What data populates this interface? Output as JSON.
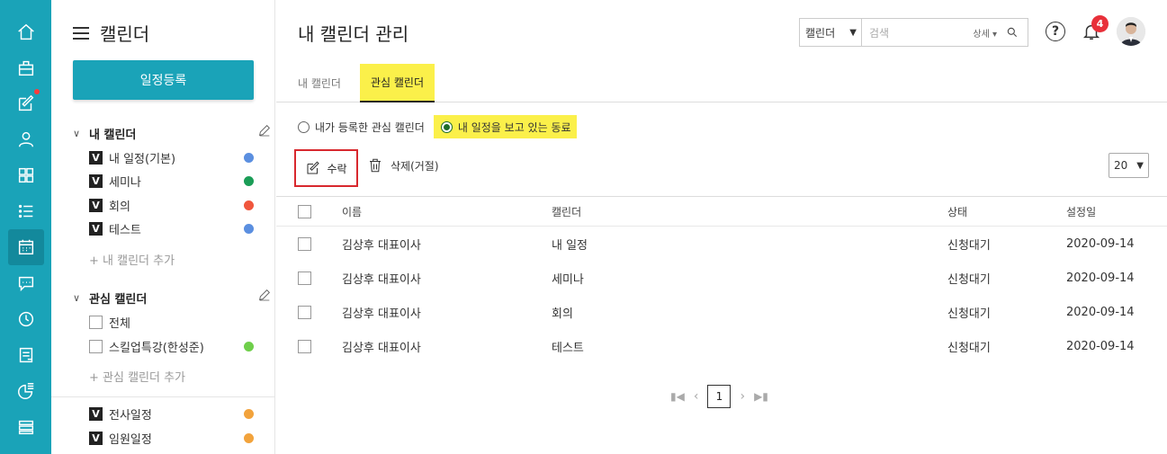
{
  "sidebar": {
    "title": "캘린더",
    "register_label": "일정등록",
    "my_section": {
      "label": "내 캘린더",
      "items": [
        {
          "label": "내 일정(기본)",
          "checked": true,
          "color": "#5b8fe0"
        },
        {
          "label": "세미나",
          "checked": true,
          "color": "#1b9d57"
        },
        {
          "label": "회의",
          "checked": true,
          "color": "#f0563d"
        },
        {
          "label": "테스트",
          "checked": true,
          "color": "#5b8fe0"
        }
      ],
      "add_label": "+ 내 캘린더 추가"
    },
    "interest_section": {
      "label": "관심 캘린더",
      "items": [
        {
          "label": "전체",
          "checked": false,
          "color": ""
        },
        {
          "label": "스킬업특강(한성준)",
          "checked": false,
          "color": "#6fcf4b"
        }
      ],
      "add_label": "+ 관심 캘린더 추가"
    },
    "shared_items": [
      {
        "label": "전사일정",
        "checked": true,
        "color": "#f2a33c"
      },
      {
        "label": "임원일정",
        "checked": true,
        "color": "#f2a33c"
      }
    ]
  },
  "header": {
    "title": "내 캘린더 관리",
    "search_scope": "캘린더",
    "search_placeholder": "검색",
    "search_detail": "상세",
    "notification_count": "4"
  },
  "tabs": [
    {
      "label": "내 캘린더",
      "active": false
    },
    {
      "label": "관심 캘린더",
      "active": true
    }
  ],
  "filters": [
    {
      "label": "내가 등록한 관심 캘린더",
      "selected": false
    },
    {
      "label": "내 일정을 보고 있는 동료",
      "selected": true
    }
  ],
  "actions": {
    "accept_label": "수락",
    "delete_label": "삭제(거절)",
    "page_size": "20"
  },
  "table": {
    "columns": [
      "이름",
      "캘린더",
      "상태",
      "설정일"
    ],
    "rows": [
      [
        "김상후 대표이사",
        "내 일정",
        "신청대기",
        "2020-09-14"
      ],
      [
        "김상후 대표이사",
        "세미나",
        "신청대기",
        "2020-09-14"
      ],
      [
        "김상후 대표이사",
        "회의",
        "신청대기",
        "2020-09-14"
      ],
      [
        "김상후 대표이사",
        "테스트",
        "신청대기",
        "2020-09-14"
      ]
    ]
  },
  "pagination": {
    "current": "1"
  },
  "colors": {
    "brand": "#1aa3b8",
    "highlight": "#fbf04a",
    "accent_red": "#d8282e"
  },
  "rail_icons": [
    "home-icon",
    "briefcase-icon",
    "edit-icon",
    "person-icon",
    "grid-icon",
    "list-icon",
    "calendar-icon",
    "chat-icon",
    "clock-icon",
    "document-icon",
    "chart-icon",
    "stack-icon"
  ]
}
